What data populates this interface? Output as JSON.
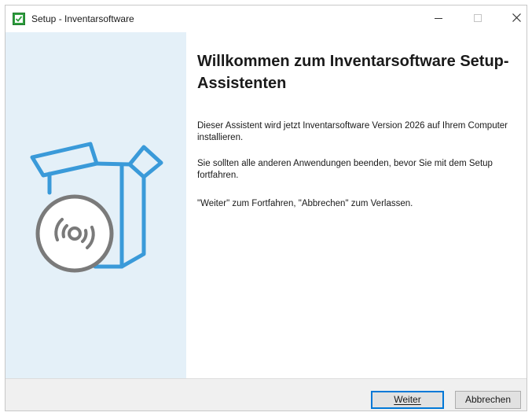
{
  "window": {
    "title": "Setup - Inventarsoftware",
    "controls": {
      "minimize_icon": "minimize-icon",
      "maximize_icon": "maximize-icon",
      "close_icon": "close-icon"
    }
  },
  "sidebar": {
    "background": "#e4f0f8",
    "art_icon": "software-box-with-disc"
  },
  "content": {
    "heading": "Willkommen zum Inventarsoftware Setup-Assistenten",
    "paragraphs": [
      "Dieser Assistent wird jetzt Inventarsoftware Version 2026 auf Ihrem Computer installieren.",
      "Sie sollten alle anderen Anwendungen beenden, bevor Sie mit dem Setup fortfahren.",
      "\"Weiter\" zum Fortfahren, \"Abbrechen\" zum Verlassen."
    ]
  },
  "footer": {
    "next_label": "Weiter",
    "cancel_label": "Abbrechen"
  },
  "colors": {
    "accent": "#0078d7",
    "art_blue": "#3a9ad9",
    "disc_gray": "#7a7a7a"
  }
}
